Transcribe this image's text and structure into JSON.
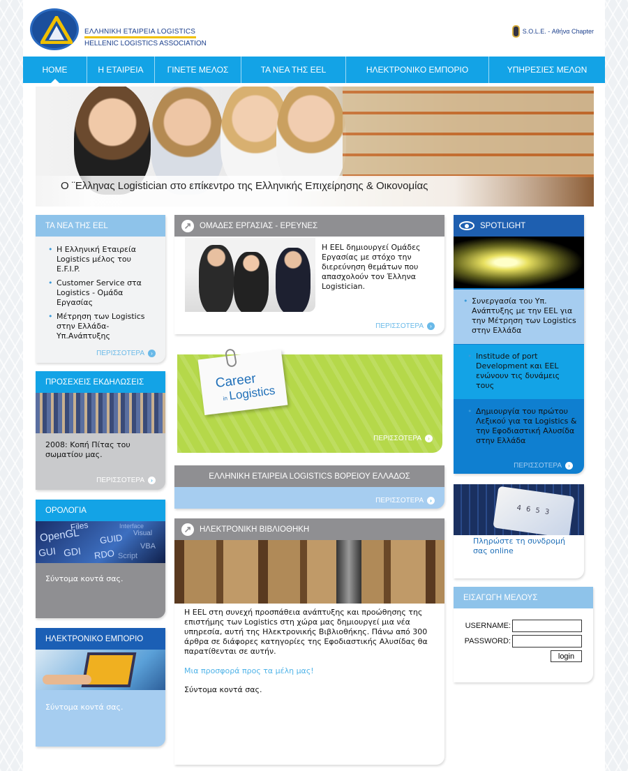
{
  "header": {
    "logo_line1": "ΕΛΛΗΝΙΚΗ ΕΤΑΙΡΕΙΑ LOGISTICS",
    "logo_line2": "HELLENIC LOGISTICS ASSOCIATION",
    "sole_label": "S.O.L.E. - Αθήνα Chapter"
  },
  "nav": {
    "items": [
      {
        "label": "HOME"
      },
      {
        "label": "Η ΕΤΑΙΡΕΙΑ"
      },
      {
        "label": "ΓΙΝΕΤΕ ΜΕΛΟΣ"
      },
      {
        "label": "ΤΑ ΝΕΑ ΤΗΣ EEL"
      },
      {
        "label": "ΗΛΕΚΤΡΟΝΙΚΟ ΕΜΠΟΡΙΟ"
      },
      {
        "label": "ΥΠΗΡΕΣΙΕΣ ΜΕΛΩΝ"
      }
    ]
  },
  "banner": {
    "caption": "Ο ¨Ελληνας Logistician στο επίκεντρο της Ελληνικής Επιχείρησης & Οικονομίας"
  },
  "more_label": "ΠΕΡΙΣΣΟΤΕΡΑ",
  "left": {
    "news": {
      "title": "ΤΑ ΝΕΑ ΤΗΣ EEL",
      "items": [
        "Η Ελληνική Εταιρεία Logistics μέλος του E.F.I.P.",
        "Customer Service στα Logistics - Ομάδα Εργασίας",
        "Μέτρηση των Logistics στην Ελλάδα- Υπ.Ανάπτυξης"
      ]
    },
    "events": {
      "title": "ΠΡΟΣΕΧΕΙΣ ΕΚΔΗΛΩΣΕΙΣ",
      "text": "2008: Κοπή Πίτας του σωματίου μας."
    },
    "terminology": {
      "title": "ΟΡΟΛΟΓΙΑ",
      "text": "Σύντομα κοντά σας.",
      "image_words": [
        "Files",
        "Interface",
        "OpenGL",
        "GUID",
        "Visual",
        "GUI",
        "GDI",
        "RDO",
        "Script",
        "VBA"
      ]
    },
    "ecommerce": {
      "title": "ΗΛΕΚΤΡΟΝΙΚΟ ΕΜΠΟΡΙΟ",
      "text": "Σύντομα κοντά σας."
    }
  },
  "center": {
    "groups": {
      "title": "ΟΜΑΔΕΣ ΕΡΓΑΣΙΑΣ - ΕΡΕΥΝΕΣ",
      "text": "Η EEL δημιουργεί Ομάδες Εργασίας με στόχο την διερεύνηση θεμάτων που απασχολούν τον Έλληνα Logistician."
    },
    "career": {
      "line1": "Career",
      "line2": "in",
      "line3": "Logistics"
    },
    "north": {
      "title": "ΕΛΛΗΝΙΚΗ ΕΤΑΙΡΕΙΑ LOGISTICS ΒΟΡΕΙΟΥ ΕΛΛΑΔΟΣ"
    },
    "library": {
      "title": "ΗΛΕΚΤΡΟΝΙΚΗ ΒΙΒΛΙΟΘΗΚΗ",
      "text": "Η EEL στη συνεχή προσπάθεια ανάπτυξης και προώθησης της επιστήμης των Logistics στη χώρα μας δημιουργεί μια νέα υπηρεσία, αυτή της Ηλεκτρονικής Βιβλιοθήκης. Πάνω από 300 άρθρα σε διάφορες κατηγορίες της Εφοδιαστικής Αλυσίδας θα παρατίθενται σε αυτήν.",
      "link": "Μια προσφορά προς τα μέλη μας!",
      "soon": "Σύντομα κοντά σας."
    }
  },
  "right": {
    "spotlight": {
      "title": "SPOTLIGHT",
      "items": [
        "Συνεργασία του Υπ. Ανάπτυξης με την EEL για την Μέτρηση των Logistics στην Ελλάδα",
        "Institude of port Development και EEL ενώνουν τις δυνάμεις τους",
        "Δημιουργία του πρώτου Λεξικού για τα Logistics & την Εφοδιαστική Αλυσίδα στην Ελλάδα"
      ]
    },
    "payment": {
      "text": "Πληρώστε τη συνδρομή σας online",
      "card_number": "4 6 5 3"
    },
    "login": {
      "title": "ΕΙΣΑΓΩΓΗ ΜΕΛΟΥΣ",
      "username_label": "USERNAME:",
      "password_label": "PASSWORD:",
      "button": "login"
    }
  },
  "colors": {
    "nav": "#13a3e6",
    "light_blue": "#8ec3ea",
    "dark_blue": "#1b5fb5",
    "gray": "#8f8f92",
    "lime": "#b5d84a"
  }
}
